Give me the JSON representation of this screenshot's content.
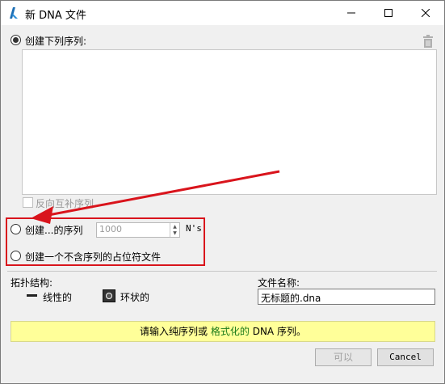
{
  "window": {
    "title": "新 DNA 文件"
  },
  "sequence_section": {
    "radio_label": "创建下列序列:",
    "textarea_value": "",
    "reverse_complement_label": "反向互补序列"
  },
  "create_n_section": {
    "label_prefix": "创建...的序列",
    "count_value": "1000",
    "suffix": "N's"
  },
  "placeholder_section": {
    "label": "创建一个不含序列的占位符文件"
  },
  "topology": {
    "heading": "拓扑结构:",
    "linear_label": "线性的",
    "circular_label": "环状的"
  },
  "file_name": {
    "label": "文件名称:",
    "value": "无标题的.dna"
  },
  "message": {
    "part1": "请输入纯序列或 ",
    "link": "格式化的",
    "part2": " DNA 序列。"
  },
  "buttons": {
    "ok": "可以",
    "cancel": "Cancel"
  },
  "colors": {
    "annotation_red": "#d9141c",
    "message_bg": "#ffff99",
    "link_green": "#1a7a1a"
  }
}
